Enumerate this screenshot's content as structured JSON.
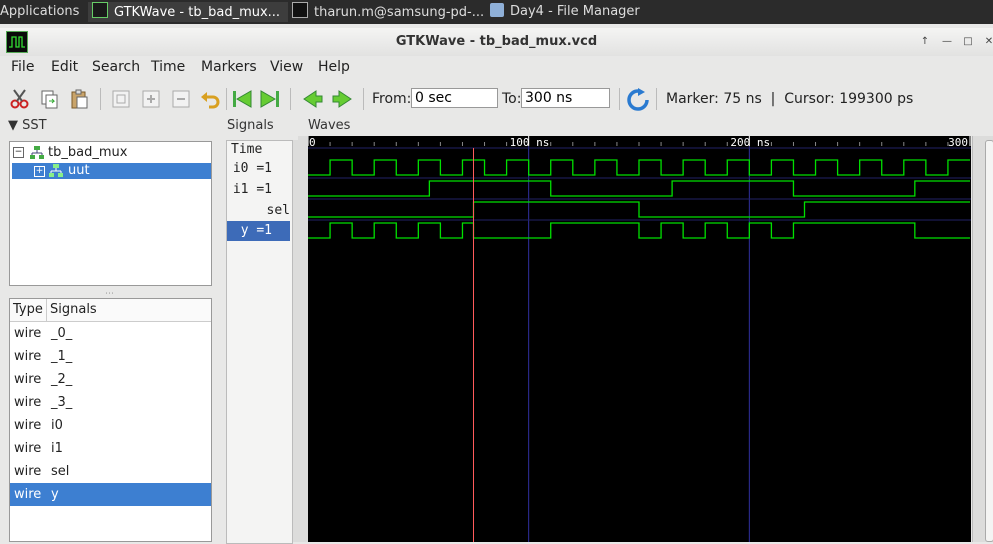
{
  "taskbar": {
    "applications": "Applications",
    "tasks": [
      "GTKWave - tb_bad_mux...",
      "tharun.m@samsung-pd-...",
      "Day4 - File Manager"
    ]
  },
  "window": {
    "title": "GTKWave - tb_bad_mux.vcd"
  },
  "menu": [
    "File",
    "Edit",
    "Search",
    "Time",
    "Markers",
    "View",
    "Help"
  ],
  "toolbar": {
    "from_label": "From:",
    "from_value": "0 sec",
    "to_label": "To:",
    "to_value": "300 ns",
    "status": "Marker: 75 ns  |  Cursor: 199300 ps"
  },
  "sst": {
    "header": "SST",
    "tree": [
      {
        "label": "tb_bad_mux"
      },
      {
        "label": "uut",
        "selected": true
      }
    ],
    "columns": [
      "Type",
      "Signals"
    ],
    "rows": [
      {
        "type": "wire",
        "name": "_0_"
      },
      {
        "type": "wire",
        "name": "_1_"
      },
      {
        "type": "wire",
        "name": "_2_"
      },
      {
        "type": "wire",
        "name": "_3_"
      },
      {
        "type": "wire",
        "name": "i0"
      },
      {
        "type": "wire",
        "name": "i1"
      },
      {
        "type": "wire",
        "name": "sel"
      },
      {
        "type": "wire",
        "name": "y"
      }
    ],
    "selected_row": 7
  },
  "signals": {
    "header": "Signals",
    "time_label": "Time",
    "items": [
      "i0 =1",
      "i1 =1",
      "sel =1",
      "y =1"
    ],
    "selected": 3
  },
  "waves": {
    "header": "Waves",
    "time_range_ns": [
      0,
      300
    ],
    "ticks": [
      "0",
      "100 ns",
      "200 ns",
      "300"
    ],
    "marker_ns": 75,
    "cursor_ns": 199.3,
    "colors": {
      "background": "#000000",
      "trace": "#00e000",
      "marker": "#ff5a5a",
      "grid": "#3030a0",
      "ruler_text": "#ffffff"
    },
    "traces": [
      {
        "name": "i0",
        "initial": 0,
        "transitions_ns": [
          10,
          20,
          30,
          40,
          50,
          60,
          70,
          80,
          90,
          100,
          110,
          120,
          130,
          140,
          150,
          160,
          170,
          180,
          190,
          200,
          210,
          220,
          230,
          240,
          250,
          260,
          270,
          280,
          290,
          300
        ]
      },
      {
        "name": "i1",
        "initial": 0,
        "transitions_ns": [
          55,
          110,
          165,
          220,
          275
        ]
      },
      {
        "name": "sel",
        "initial": 0,
        "transitions_ns": [
          75,
          150,
          225
        ]
      },
      {
        "name": "y",
        "initial": 0,
        "transitions_ns": [
          10,
          20,
          30,
          40,
          50,
          60,
          70,
          75,
          110,
          150,
          160,
          170,
          180,
          190,
          200,
          210,
          220,
          275
        ]
      }
    ]
  }
}
